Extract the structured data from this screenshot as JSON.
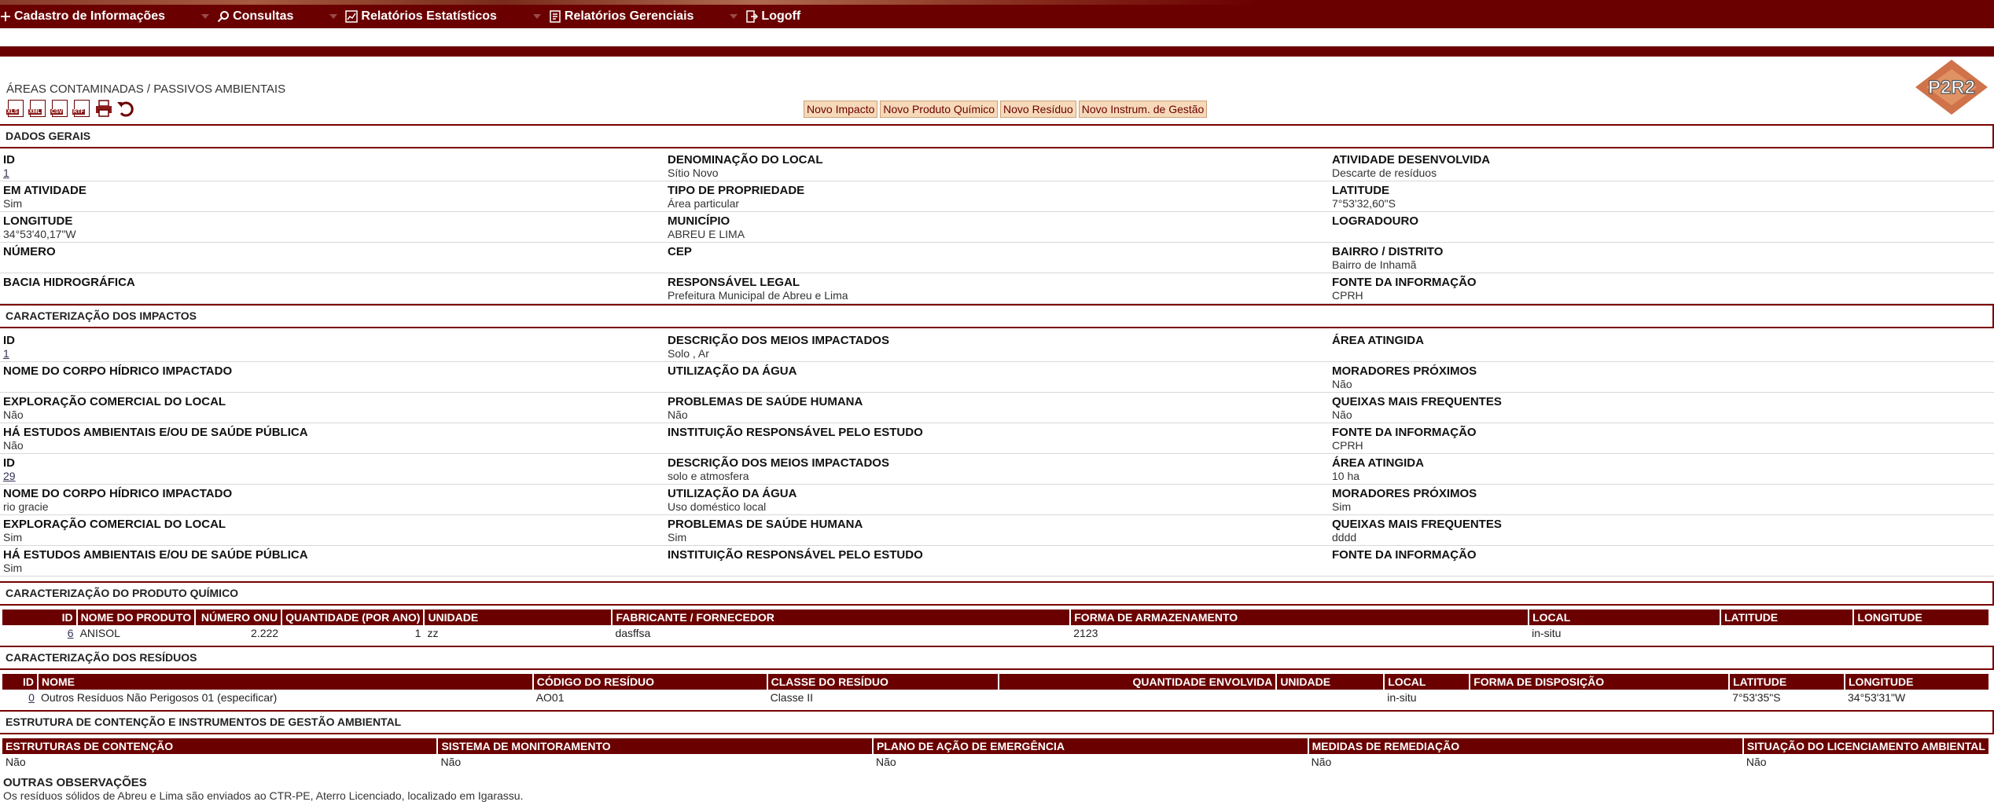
{
  "menu": [
    {
      "label": "Cadastro de Informações",
      "icon": "plus-icon"
    },
    {
      "label": "Consultas",
      "icon": "search-icon"
    },
    {
      "label": "Relatórios Estatísticos",
      "icon": "chart-icon"
    },
    {
      "label": "Relatórios Gerenciais",
      "icon": "report-icon"
    },
    {
      "label": "Logoff",
      "icon": "logoff-icon"
    }
  ],
  "page_title": "ÁREAS CONTAMINADAS / PASSIVOS AMBIENTAIS",
  "logo_text": "P2R2",
  "export_icons": [
    "XLS",
    "XML",
    "CSV",
    "RTF"
  ],
  "actions": [
    "Novo Impacto",
    "Novo Produto Químico",
    "Novo Resíduo",
    "Novo Instrum. de Gestão"
  ],
  "sections": {
    "dados_gerais": "DADOS GERAIS",
    "impactos": "CARACTERIZAÇÃO DOS IMPACTOS",
    "produto": "CARACTERIZAÇÃO DO PRODUTO QUÍMICO",
    "residuos": "CARACTERIZAÇÃO DOS RESÍDUOS",
    "estrutura": "ESTRUTURA DE CONTENÇÃO E INSTRUMENTOS DE GESTÃO AMBIENTAL"
  },
  "dados": [
    [
      {
        "k": "ID",
        "v": "1",
        "link": true
      },
      {
        "k": "DENOMINAÇÃO DO LOCAL",
        "v": "Sítio Novo"
      },
      {
        "k": "ATIVIDADE DESENVOLVIDA",
        "v": "Descarte de resíduos"
      }
    ],
    [
      {
        "k": "EM ATIVIDADE",
        "v": "Sim"
      },
      {
        "k": "TIPO DE PROPRIEDADE",
        "v": "Área particular"
      },
      {
        "k": "LATITUDE",
        "v": "7°53'32,60\"S"
      }
    ],
    [
      {
        "k": "LONGITUDE",
        "v": "34°53'40,17\"W"
      },
      {
        "k": "MUNICÍPIO",
        "v": "ABREU E LIMA"
      },
      {
        "k": "LOGRADOURO",
        "v": ""
      }
    ],
    [
      {
        "k": "NÚMERO",
        "v": ""
      },
      {
        "k": "CEP",
        "v": ""
      },
      {
        "k": "BAIRRO / DISTRITO",
        "v": "Bairro de Inhamã"
      }
    ],
    [
      {
        "k": "BACIA HIDROGRÁFICA",
        "v": ""
      },
      {
        "k": "RESPONSÁVEL LEGAL",
        "v": "Prefeitura Municipal de Abreu e Lima"
      },
      {
        "k": "FONTE DA INFORMAÇÃO",
        "v": "CPRH"
      }
    ]
  ],
  "impactos": [
    [
      {
        "k": "ID",
        "v": "1",
        "link": true
      },
      {
        "k": "DESCRIÇÃO DOS MEIOS IMPACTADOS",
        "v": "Solo , Ar"
      },
      {
        "k": "ÁREA ATINGIDA",
        "v": ""
      }
    ],
    [
      {
        "k": "NOME DO CORPO HÍDRICO IMPACTADO",
        "v": ""
      },
      {
        "k": "UTILIZAÇÃO DA ÁGUA",
        "v": ""
      },
      {
        "k": "MORADORES PRÓXIMOS",
        "v": "Não"
      }
    ],
    [
      {
        "k": "EXPLORAÇÃO COMERCIAL DO LOCAL",
        "v": "Não"
      },
      {
        "k": "PROBLEMAS DE SAÚDE HUMANA",
        "v": "Não"
      },
      {
        "k": "QUEIXAS MAIS FREQUENTES",
        "v": "Não"
      }
    ],
    [
      {
        "k": "HÁ ESTUDOS AMBIENTAIS E/OU DE SAÚDE PÚBLICA",
        "v": "Não"
      },
      {
        "k": "INSTITUIÇÃO RESPONSÁVEL PELO ESTUDO",
        "v": ""
      },
      {
        "k": "FONTE DA INFORMAÇÃO",
        "v": "CPRH"
      }
    ],
    [
      {
        "k": "ID",
        "v": "29",
        "link": true
      },
      {
        "k": "DESCRIÇÃO DOS MEIOS IMPACTADOS",
        "v": "solo e atmosfera"
      },
      {
        "k": "ÁREA ATINGIDA",
        "v": "10 ha"
      }
    ],
    [
      {
        "k": "NOME DO CORPO HÍDRICO IMPACTADO",
        "v": "rio gracie"
      },
      {
        "k": "UTILIZAÇÃO DA ÁGUA",
        "v": "Uso doméstico local"
      },
      {
        "k": "MORADORES PRÓXIMOS",
        "v": "Sim"
      }
    ],
    [
      {
        "k": "EXPLORAÇÃO COMERCIAL DO LOCAL",
        "v": "Sim"
      },
      {
        "k": "PROBLEMAS DE SAÚDE HUMANA",
        "v": "Sim"
      },
      {
        "k": "QUEIXAS MAIS FREQUENTES",
        "v": "dddd"
      }
    ],
    [
      {
        "k": "HÁ ESTUDOS AMBIENTAIS E/OU DE SAÚDE PÚBLICA",
        "v": "Sim"
      },
      {
        "k": "INSTITUIÇÃO RESPONSÁVEL PELO ESTUDO",
        "v": ""
      },
      {
        "k": "FONTE DA INFORMAÇÃO",
        "v": ""
      }
    ]
  ],
  "produto": {
    "headers": [
      "ID",
      "NOME DO PRODUTO",
      "NÚMERO ONU",
      "QUANTIDADE (POR ANO)",
      "UNIDADE",
      "FABRICANTE / FORNECEDOR",
      "FORMA DE ARMAZENAMENTO",
      "LOCAL",
      "LATITUDE",
      "LONGITUDE"
    ],
    "rows": [
      [
        "6",
        "ANISOL",
        "2.222",
        "1",
        "zz",
        "dasffsa",
        "2123",
        "in-situ",
        "",
        ""
      ]
    ]
  },
  "residuos": {
    "headers": [
      "ID",
      "NOME",
      "CÓDIGO DO RESÍDUO",
      "CLASSE DO RESÍDUO",
      "QUANTIDADE ENVOLVIDA",
      "UNIDADE",
      "LOCAL",
      "FORMA DE DISPOSIÇÃO",
      "LATITUDE",
      "LONGITUDE"
    ],
    "rows": [
      [
        "0",
        "Outros Resíduos Não Perigosos 01 (especificar)",
        "AO01",
        "Classe II",
        "",
        "",
        "in-situ",
        "",
        "7°53'35\"S",
        "34°53'31\"W"
      ]
    ]
  },
  "estrutura": {
    "headers": [
      "ESTRUTURAS DE CONTENÇÃO",
      "SISTEMA DE MONITORAMENTO",
      "PLANO DE AÇÃO DE EMERGÊNCIA",
      "MEDIDAS DE REMEDIAÇÃO",
      "SITUAÇÃO DO LICENCIAMENTO AMBIENTAL"
    ],
    "rows": [
      [
        "Não",
        "Não",
        "Não",
        "Não",
        "Não"
      ]
    ]
  },
  "outras": {
    "k": "OUTRAS OBSERVAÇÕES",
    "v": "Os resíduos sólidos de Abreu e Lima são enviados ao CTR-PE, Aterro Licenciado, localizado em Igarassu."
  },
  "colors": {
    "brand": "#6b0000",
    "button_bg": "#f6d9b8"
  }
}
